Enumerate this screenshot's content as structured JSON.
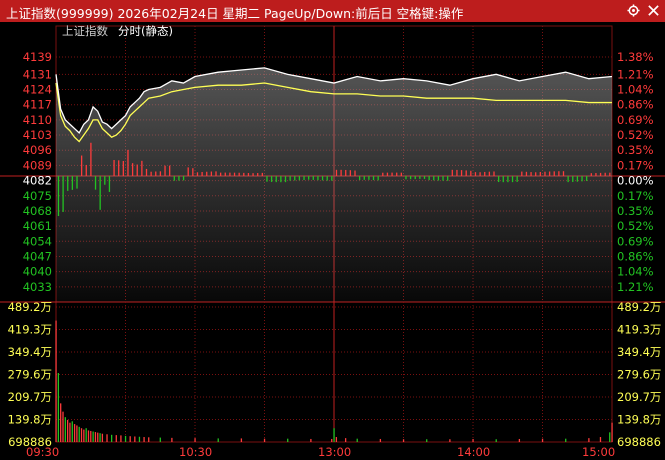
{
  "header": {
    "title": "上证指数(999999)  2026年02月24日  星期二  PageUp/Down:前后日  空格键:操作",
    "index_label": "上证指数",
    "mode_label": "分时(静态)",
    "icons": [
      "gear-icon",
      "close-icon"
    ]
  },
  "colors": {
    "background": "#000000",
    "titlebar": "#bd1d1d",
    "grid": "#7a1010",
    "up": "#ff3b3b",
    "down": "#22c322",
    "price_line": "#ffffff",
    "avg_line": "#ffff55"
  },
  "chart_data": [
    {
      "type": "line",
      "title": "",
      "reference_price": 4082,
      "ylim": [
        4026,
        4145
      ],
      "y_ticks": [
        4139,
        4131,
        4124,
        4117,
        4110,
        4103,
        4096,
        4089,
        4082,
        4075,
        4068,
        4061,
        4054,
        4047,
        4040,
        4033
      ],
      "pct_ticks": [
        "1.38%",
        "1.21%",
        "1.04%",
        "0.86%",
        "0.69%",
        "0.52%",
        "0.35%",
        "0.17%",
        "0.00%",
        "0.17%",
        "0.35%",
        "0.52%",
        "0.69%",
        "0.86%",
        "1.04%",
        "1.21%"
      ],
      "x_ticks": [
        "09:30",
        "10:30",
        "13:00",
        "14:00",
        "15:00"
      ],
      "series": [
        {
          "key": "price",
          "x": [
            0,
            2,
            4,
            6,
            8,
            10,
            12,
            14,
            16,
            18,
            20,
            22,
            24,
            26,
            28,
            30,
            32,
            34,
            36,
            38,
            40,
            45,
            50,
            55,
            60,
            70,
            80,
            90,
            100,
            110,
            120,
            130,
            140,
            150,
            160,
            170,
            180,
            190,
            200,
            210,
            220,
            230,
            240
          ],
          "values": [
            4131,
            4115,
            4110,
            4108,
            4106,
            4104,
            4108,
            4110,
            4116,
            4114,
            4109,
            4108,
            4106,
            4108,
            4110,
            4112,
            4116,
            4118,
            4120,
            4123,
            4124,
            4125,
            4128,
            4127,
            4130,
            4132,
            4133,
            4134,
            4131,
            4129,
            4127,
            4130,
            4128,
            4129,
            4128,
            4126,
            4129,
            4131,
            4128,
            4130,
            4132,
            4129,
            4130
          ]
        },
        {
          "key": "average",
          "x": [
            0,
            2,
            4,
            6,
            8,
            10,
            12,
            14,
            16,
            18,
            20,
            22,
            24,
            26,
            28,
            30,
            32,
            34,
            36,
            38,
            40,
            45,
            50,
            55,
            60,
            70,
            80,
            90,
            100,
            110,
            120,
            130,
            140,
            150,
            160,
            170,
            180,
            190,
            200,
            210,
            220,
            230,
            240
          ],
          "values": [
            4127,
            4112,
            4107,
            4105,
            4102,
            4100,
            4103,
            4106,
            4110,
            4110,
            4106,
            4104,
            4102,
            4103,
            4105,
            4108,
            4112,
            4114,
            4116,
            4118,
            4120,
            4121,
            4123,
            4124,
            4125,
            4126,
            4126,
            4127,
            4125,
            4123,
            4122,
            4122,
            4121,
            4121,
            4120,
            4120,
            4120,
            4119,
            4119,
            4119,
            4119,
            4118,
            4118
          ]
        }
      ]
    },
    {
      "type": "bar",
      "title": "",
      "ylim": [
        0,
        489.2
      ],
      "unit": "万",
      "y_ticks": [
        "489.2万",
        "419.3万",
        "349.4万",
        "279.6万",
        "209.7万",
        "139.8万",
        "698886"
      ],
      "x": [
        0,
        1,
        2,
        3,
        4,
        5,
        6,
        7,
        8,
        9,
        10,
        11,
        12,
        13,
        14,
        15,
        16,
        17,
        18,
        19,
        20,
        22,
        24,
        26,
        28,
        30,
        32,
        34,
        36,
        38,
        40,
        45,
        50,
        60,
        70,
        80,
        90,
        100,
        110,
        119,
        120,
        121,
        125,
        130,
        140,
        150,
        160,
        170,
        180,
        190,
        200,
        210,
        220,
        230,
        235,
        239,
        240
      ],
      "values": [
        440,
        250,
        140,
        110,
        90,
        80,
        70,
        75,
        65,
        60,
        55,
        50,
        45,
        50,
        42,
        40,
        38,
        36,
        34,
        32,
        30,
        28,
        26,
        25,
        24,
        22,
        21,
        20,
        19,
        18,
        17,
        16,
        15,
        14,
        13,
        13,
        12,
        12,
        11,
        11,
        50,
        18,
        14,
        12,
        11,
        10,
        10,
        10,
        11,
        10,
        11,
        12,
        12,
        14,
        18,
        35,
        70
      ]
    }
  ]
}
